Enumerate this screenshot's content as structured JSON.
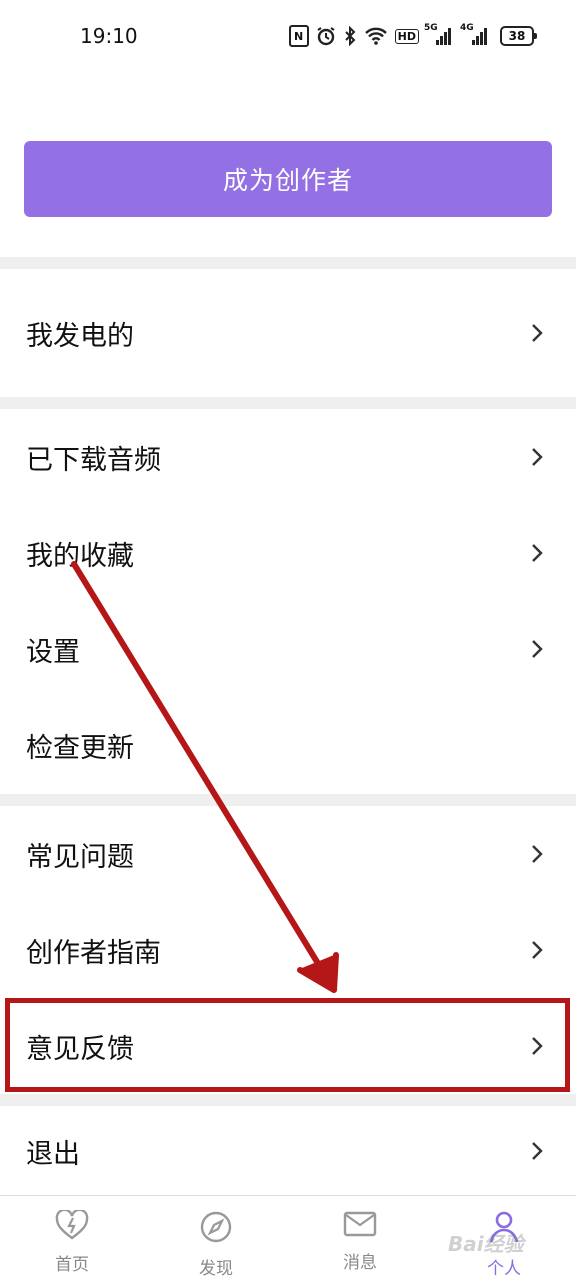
{
  "status_bar": {
    "time": "19:10",
    "battery": "38",
    "icons": [
      "nfc-icon",
      "alarm-icon",
      "bluetooth-icon",
      "wifi-icon",
      "hd-icon",
      "signal-5g-icon",
      "signal-4g-icon",
      "battery-icon"
    ],
    "hd_label": "HD",
    "sig1_label": "5G",
    "sig2_label": "4G"
  },
  "creator_button": {
    "label": "成为创作者",
    "color": "#9370e4"
  },
  "menu": {
    "powered": "我发电的",
    "downloaded_audio": "已下载音频",
    "favorites": "我的收藏",
    "settings": "设置",
    "check_update": "检查更新",
    "faq": "常见问题",
    "creator_guide": "创作者指南",
    "feedback": "意见反馈",
    "logout": "退出"
  },
  "annotation": {
    "highlight_color": "#b51617",
    "target": "意见反馈"
  },
  "tabs": [
    {
      "label": "首页",
      "icon": "heart-bolt-icon",
      "active": false
    },
    {
      "label": "发现",
      "icon": "compass-icon",
      "active": false
    },
    {
      "label": "消息",
      "icon": "mail-icon",
      "active": false
    },
    {
      "label": "个人",
      "icon": "person-icon",
      "active": true
    }
  ],
  "accent_color": "#8a6ce0",
  "watermark": "Bai经验"
}
